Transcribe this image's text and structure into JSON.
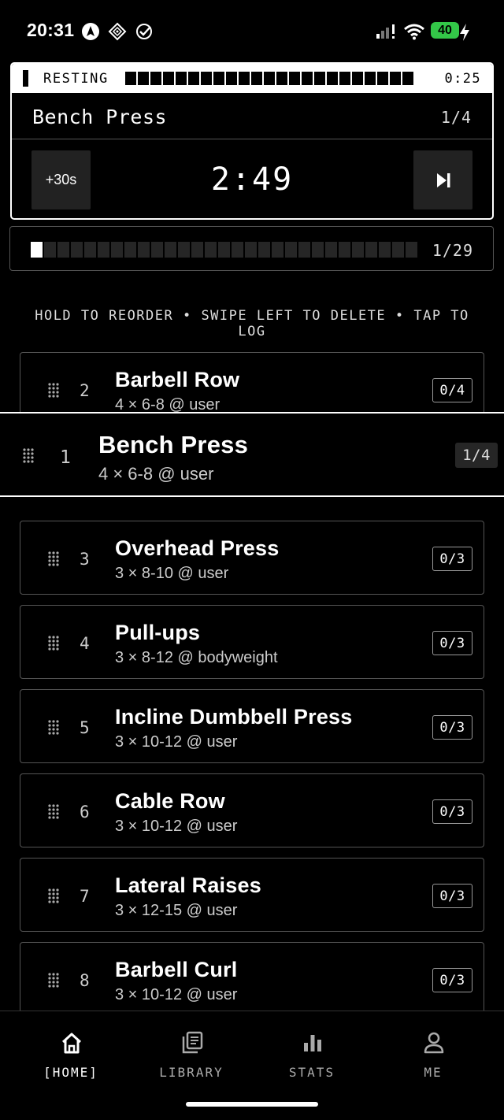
{
  "status_bar": {
    "time": "20:31",
    "battery": "40"
  },
  "rest_timer": {
    "state_label": "RESTING",
    "countdown": "0:25",
    "exercise": "Bench Press",
    "set_progress": "1/4",
    "add_time_label": "+30s",
    "main_timer": "2:49"
  },
  "workout_progress": {
    "completed_sets": 1,
    "total_sets": 29,
    "label": "1/29"
  },
  "hint": "HOLD TO REORDER • SWIPE LEFT TO DELETE • TAP TO LOG",
  "exercises": [
    {
      "num": "1",
      "name": "Bench Press",
      "detail": "4 × 6-8 @ user",
      "progress": "1/4"
    },
    {
      "num": "2",
      "name": "Barbell Row",
      "detail": "4 × 6-8 @ user",
      "progress": "0/4"
    },
    {
      "num": "3",
      "name": "Overhead Press",
      "detail": "3 × 8-10 @ user",
      "progress": "0/3"
    },
    {
      "num": "4",
      "name": "Pull-ups",
      "detail": "3 × 8-12 @ bodyweight",
      "progress": "0/3"
    },
    {
      "num": "5",
      "name": "Incline Dumbbell Press",
      "detail": "3 × 10-12 @ user",
      "progress": "0/3"
    },
    {
      "num": "6",
      "name": "Cable Row",
      "detail": "3 × 10-12 @ user",
      "progress": "0/3"
    },
    {
      "num": "7",
      "name": "Lateral Raises",
      "detail": "3 × 12-15 @ user",
      "progress": "0/3"
    },
    {
      "num": "8",
      "name": "Barbell Curl",
      "detail": "3 × 10-12 @ user",
      "progress": "0/3"
    }
  ],
  "tabs": [
    {
      "label": "[HOME]",
      "icon": "home-icon",
      "active": true
    },
    {
      "label": "LIBRARY",
      "icon": "library-icon",
      "active": false
    },
    {
      "label": "STATS",
      "icon": "stats-icon",
      "active": false
    },
    {
      "label": "ME",
      "icon": "person-icon",
      "active": false
    }
  ],
  "colors": {
    "background": "#000000",
    "foreground": "#ffffff",
    "battery": "#33c748"
  }
}
